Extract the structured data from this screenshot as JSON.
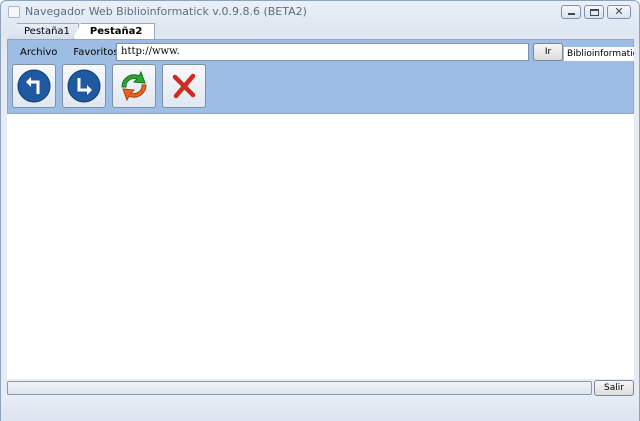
{
  "window": {
    "title": "Navegador Web Biblioinformatick v.0.9.8.6 (BETA2)",
    "controls": {
      "minimize_icon": "minimize-icon",
      "maximize_icon": "maximize-icon",
      "close_glyph": "✕"
    }
  },
  "tabs": [
    {
      "label": "Pestaña1",
      "active": false
    },
    {
      "label": "Pestaña2",
      "active": true
    }
  ],
  "menu": {
    "file_label": "Archivo",
    "favorites_label": "Favoritos"
  },
  "address_bar": {
    "value": "http://www."
  },
  "go_button": {
    "label": "Ir"
  },
  "brand": {
    "label": "Biblioinformatick ®"
  },
  "navigation": {
    "back_icon": "back-arrow-icon",
    "forward_icon": "forward-arrow-icon",
    "refresh_icon": "refresh-icon",
    "stop_icon": "stop-icon"
  },
  "colors": {
    "toolbar_bg": "#9ebde4",
    "nav_circle": "#1f5aa0",
    "refresh_green": "#2aa832",
    "refresh_orange": "#e8641e",
    "stop_red": "#d12a1f"
  },
  "footer": {
    "exit_label": "Salir",
    "status_text": ""
  }
}
